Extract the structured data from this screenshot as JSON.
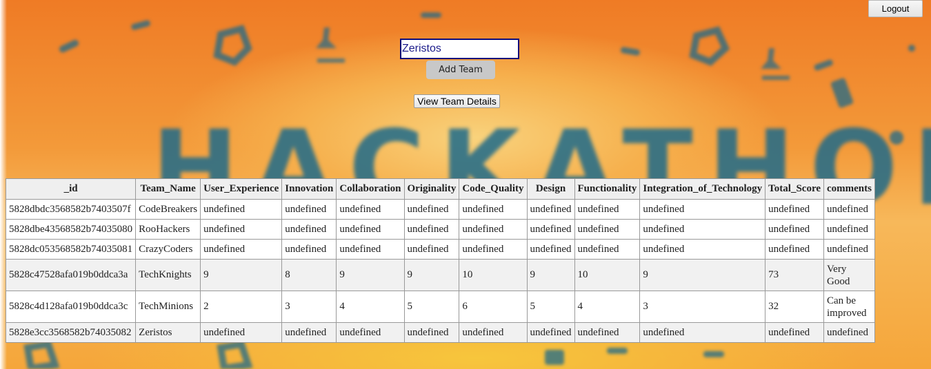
{
  "header": {
    "logout_label": "Logout"
  },
  "form": {
    "team_name_value": "Zeristos",
    "add_team_label": "Add Team",
    "view_details_label": "View Team Details"
  },
  "background": {
    "banner_text": "HACKATHON"
  },
  "table": {
    "columns": [
      "_id",
      "Team_Name",
      "User_Experience",
      "Innovation",
      "Collaboration",
      "Originality",
      "Code_Quality",
      "Design",
      "Functionality",
      "Integration_of_Technology",
      "Total_Score",
      "comments"
    ],
    "rows": [
      [
        "5828dbdc3568582b7403507f",
        "CodeBreakers",
        "undefined",
        "undefined",
        "undefined",
        "undefined",
        "undefined",
        "undefined",
        "undefined",
        "undefined",
        "undefined",
        "undefined"
      ],
      [
        "5828dbe43568582b74035080",
        "RooHackers",
        "undefined",
        "undefined",
        "undefined",
        "undefined",
        "undefined",
        "undefined",
        "undefined",
        "undefined",
        "undefined",
        "undefined"
      ],
      [
        "5828dc053568582b74035081",
        "CrazyCoders",
        "undefined",
        "undefined",
        "undefined",
        "undefined",
        "undefined",
        "undefined",
        "undefined",
        "undefined",
        "undefined",
        "undefined"
      ],
      [
        "5828c47528afa019b0ddca3a",
        "TechKnights",
        "9",
        "8",
        "9",
        "9",
        "10",
        "9",
        "10",
        "9",
        "73",
        "Very Good"
      ],
      [
        "5828c4d128afa019b0ddca3c",
        "TechMinions",
        "2",
        "3",
        "4",
        "5",
        "6",
        "5",
        "4",
        "3",
        "32",
        "Can be improved"
      ],
      [
        "5828e3cc3568582b74035082",
        "Zeristos",
        "undefined",
        "undefined",
        "undefined",
        "undefined",
        "undefined",
        "undefined",
        "undefined",
        "undefined",
        "undefined",
        "undefined"
      ]
    ]
  },
  "colors": {
    "background_orange": "#f08a2c",
    "banner_blue": "#1e6a8a",
    "input_border": "#0a0a7a",
    "input_text": "#1b1b8a",
    "header_row_bg": "#efefef",
    "alt_row_bg": "#f1f1f1"
  }
}
